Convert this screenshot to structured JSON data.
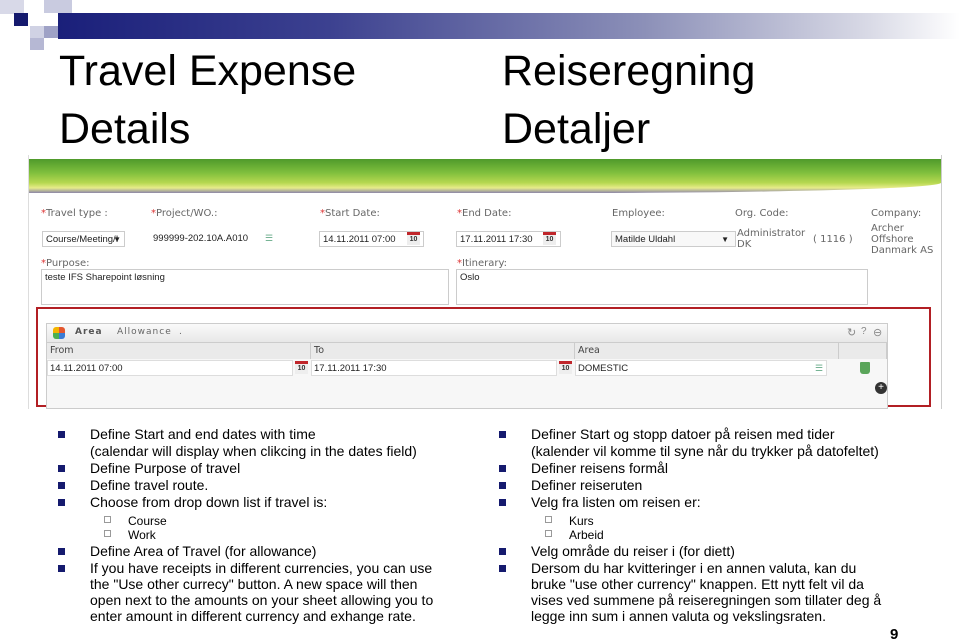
{
  "slide": {
    "title_en_line1": "Travel Expense",
    "title_en_line2": "Details",
    "title_no_line1": "Reiseregning",
    "title_no_line2": "Detaljer",
    "page_number": "9"
  },
  "form": {
    "travel_type": {
      "label": "Travel type :",
      "value": "Course/Meeting/I"
    },
    "project": {
      "label": "Project/WO.:",
      "value": "999999-202.10A.A010"
    },
    "start_date": {
      "label": "Start Date:",
      "value": "14.11.2011 07:00"
    },
    "end_date": {
      "label": "End Date:",
      "value": "17.11.2011 17:30"
    },
    "employee": {
      "label": "Employee:",
      "value": "Matilde Uldahl"
    },
    "org_code": {
      "label": "Org. Code:",
      "name_line1": "Administrator",
      "name_line2": "DK",
      "code": "( 1116 )"
    },
    "company": {
      "label": "Company:",
      "line1": "Archer",
      "line2": "Offshore",
      "line3": "Danmark AS"
    },
    "purpose": {
      "label": "Purpose:",
      "value": "teste IFS Sharepoint løsning"
    },
    "itinerary": {
      "label": "Itinerary:",
      "value": "Oslo"
    },
    "required_mark": "*",
    "calendar_day": "10"
  },
  "area_panel": {
    "breadcrumbs": [
      "Area",
      "Allowance",
      "."
    ],
    "columns": [
      "From",
      "To",
      "Area"
    ],
    "row": {
      "from": "14.11.2011 07:00",
      "to": "17.11.2011 17:30",
      "area": "DOMESTIC"
    }
  },
  "bullets_en": {
    "b1_line1": "Define Start and end dates with time",
    "b1_line2": "(calendar will display when clikcing in the dates field)",
    "b2": "Define Purpose of travel",
    "b3": "Define travel route.",
    "b4": "Choose from drop down list if travel is:",
    "sub1": "Course",
    "sub2": "Work",
    "b5": "Define Area of Travel (for allowance)",
    "b6_line1": "If you have receipts in different currencies, you can use",
    "b6_line2": "the \"Use other currecy\" button. A new space will then",
    "b6_line3": "open next to the amounts on your sheet allowing you to",
    "b6_line4": "enter amount in different currency and exhange rate."
  },
  "bullets_no": {
    "b1_line1": "Definer Start og stopp datoer på reisen med tider",
    "b1_line2": "(kalender vil komme til syne når du trykker på datofeltet)",
    "b2": "Definer reisens formål",
    "b3": "Definer reiseruten",
    "b4": "Velg fra listen om reisen er:",
    "sub1": "Kurs",
    "sub2": "Arbeid",
    "b5": "Velg område du reiser i (for diett)",
    "b6_line1": "Dersom du har kvitteringer i en annen valuta, kan du",
    "b6_line2": "bruke \"use other currency\" knappen. Ett nytt felt vil da",
    "b6_line3": "vises ved summene på reiseregningen som tillater deg å",
    "b6_line4": "legge inn sum i annen valuta og vekslingsraten."
  }
}
